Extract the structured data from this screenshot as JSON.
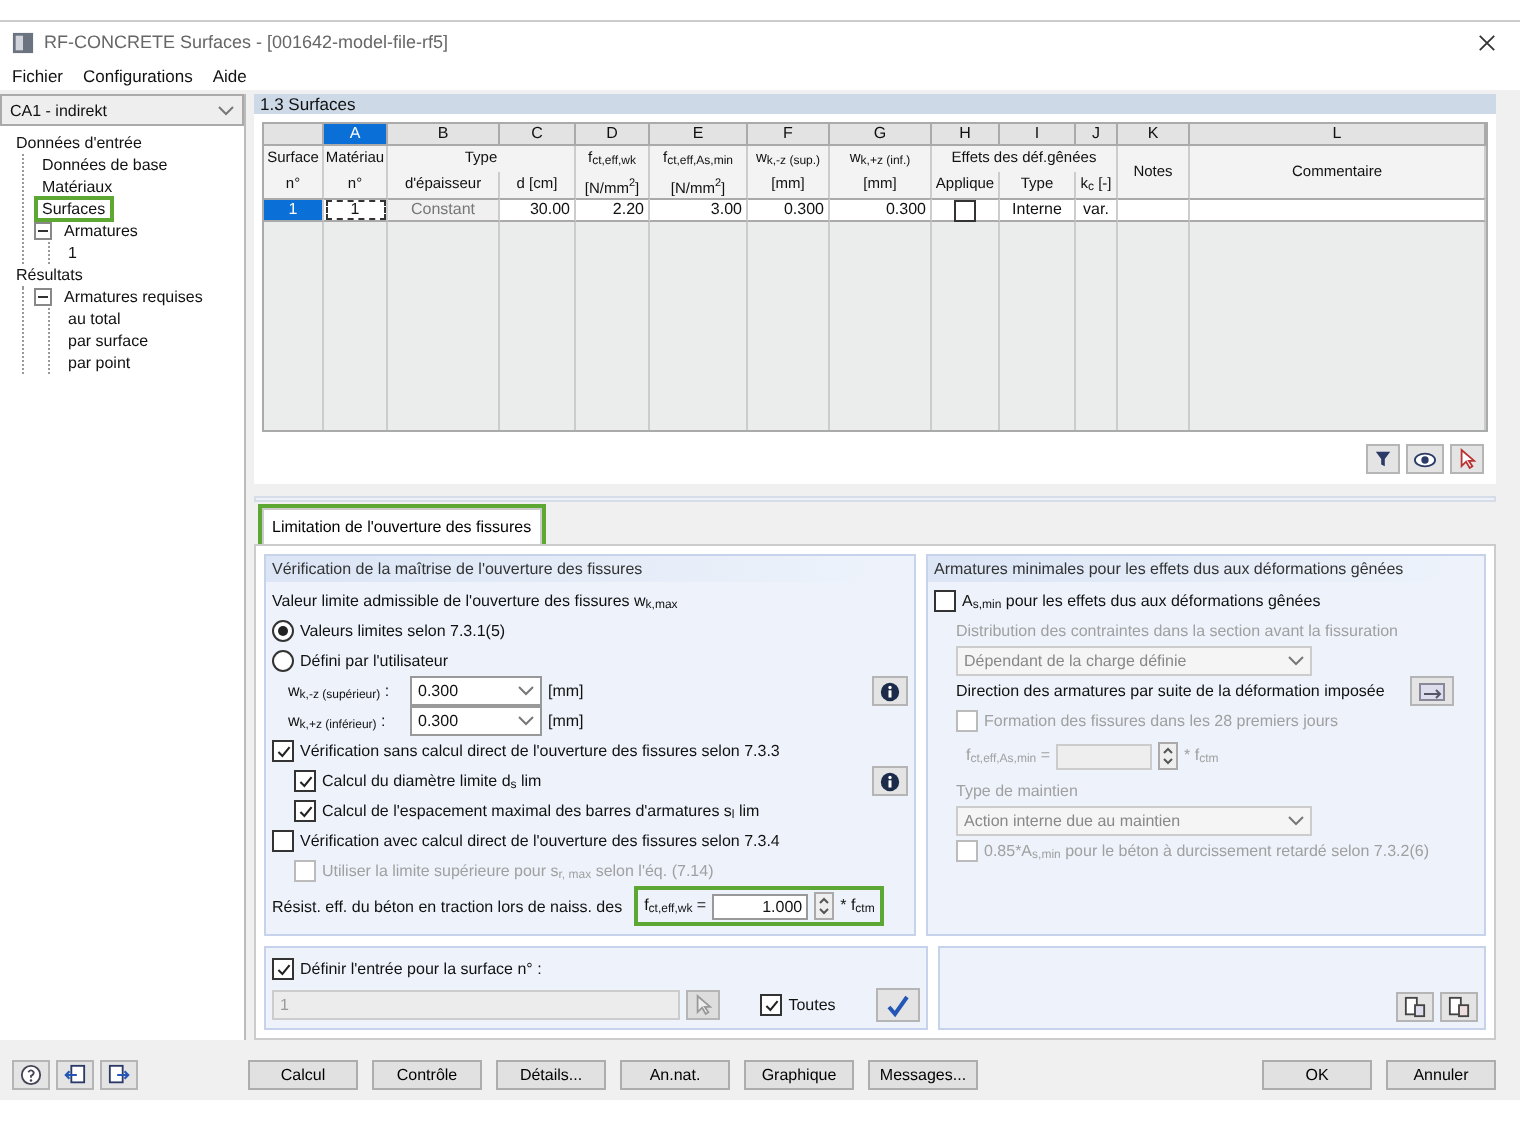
{
  "window": {
    "title": "RF-CONCRETE Surfaces - [001642-model-file-rf5]"
  },
  "menu": [
    "Fichier",
    "Configurations",
    "Aide"
  ],
  "case_select": {
    "value": "CA1 - indirekt"
  },
  "tree": [
    {
      "label": "Données d'entrée",
      "children": [
        {
          "label": "Données de base",
          "highlighted": false
        },
        {
          "label": "Matériaux",
          "highlighted": false
        },
        {
          "label": "Surfaces",
          "highlighted": true
        },
        {
          "label": "Armatures",
          "highlighted": false,
          "expanded": true,
          "children": [
            {
              "label": "1",
              "highlighted": false
            }
          ]
        }
      ]
    },
    {
      "label": "Résultats",
      "children": [
        {
          "label": "Armatures requises",
          "highlighted": false,
          "expanded": true,
          "children": [
            {
              "label": "au total",
              "highlighted": false
            },
            {
              "label": "par surface",
              "highlighted": false
            },
            {
              "label": "par point",
              "highlighted": false
            }
          ]
        }
      ]
    }
  ],
  "section_title": "1.3 Surfaces",
  "table": {
    "columns": [
      {
        "top": "Surface",
        "bottom": "n°",
        "selected": false
      },
      {
        "letter": "A",
        "top": "Matériau",
        "bottom": "n°",
        "selected": true
      },
      {
        "letter": "B",
        "top": "Type",
        "bottom": "d'épaisseur",
        "selected": false
      },
      {
        "letter": "C",
        "bottom": "d [cm]",
        "selected": false
      },
      {
        "letter": "D",
        "top": "f$_{ct,eff,wk}$",
        "bottom": "[N/mm$^{2}$]",
        "selected": false
      },
      {
        "letter": "E",
        "top": "f$_{ct,eff,As,min}$",
        "bottom": "[N/mm$^{2}$]",
        "selected": false
      },
      {
        "letter": "F",
        "top": "w$_{k,-z (sup.)}$",
        "bottom": "[mm]",
        "selected": false
      },
      {
        "letter": "G",
        "top": "w$_{k,+z (inf.)}$",
        "bottom": "[mm]",
        "selected": false
      },
      {
        "letter": "H",
        "top": "Effets des déf.gênées",
        "bottom": "Applique",
        "selected": false
      },
      {
        "letter": "I",
        "bottom": "Type",
        "selected": false
      },
      {
        "letter": "J",
        "bottom": "k$_{c}$ [-]",
        "selected": false
      },
      {
        "letter": "K",
        "header": "Notes",
        "selected": false
      },
      {
        "letter": "L",
        "header": "Commentaire",
        "selected": false
      }
    ],
    "rows": [
      {
        "selected": true,
        "cells": [
          {
            "kind": "id",
            "text": "1"
          },
          {
            "kind": "text",
            "text": "1",
            "focused": true,
            "disabled": false
          },
          {
            "kind": "text",
            "text": "Constant",
            "disabled": true,
            "focused": false
          },
          {
            "kind": "number",
            "text": "30.00"
          },
          {
            "kind": "number",
            "text": "2.20"
          },
          {
            "kind": "number",
            "text": "3.00"
          },
          {
            "kind": "number",
            "text": "0.300"
          },
          {
            "kind": "number",
            "text": "0.300"
          },
          {
            "kind": "check",
            "checked": false
          },
          {
            "kind": "text",
            "text": "Interne",
            "disabled": false,
            "focused": false
          },
          {
            "kind": "text",
            "text": "var.",
            "disabled": false,
            "focused": false
          }
        ]
      }
    ]
  },
  "tabs": [
    {
      "label": "Limitation de l'ouverture des fissures",
      "selected": true,
      "highlighted": true
    }
  ],
  "crack_group": {
    "title": "Vérification de la maîtrise de l'ouverture des fissures",
    "items": [
      {
        "kind": "heading",
        "text": "Valeur limite admissible de l'ouverture des fissures w$_{k,max}$"
      },
      {
        "kind": "radio",
        "label": "Valeurs limites selon 7.3.1(5)",
        "selected": true
      },
      {
        "kind": "radio",
        "label": "Défini par l'utilisateur",
        "selected": false
      },
      {
        "kind": "combo",
        "label": "w$_{k,-z (supérieur)}$ :",
        "value": "0.300",
        "unit": "[mm]",
        "info": true
      },
      {
        "kind": "combo",
        "label": "w$_{k,+z (inférieur)}$ :",
        "value": "0.300",
        "unit": "[mm]"
      },
      {
        "kind": "check",
        "label": "Vérification sans calcul direct de l'ouverture des fissures selon 7.3.3",
        "checked": true,
        "disabled": false,
        "children": [
          {
            "kind": "check",
            "label": "Calcul du diamètre limite d$_{s}$ lim",
            "checked": true,
            "disabled": false,
            "info": true
          },
          {
            "kind": "check",
            "label": "Calcul de l'espacement maximal des barres d'armatures s$_{l}$ lim",
            "checked": true,
            "disabled": false
          }
        ]
      },
      {
        "kind": "check",
        "label": "Vérification avec calcul direct de l'ouverture des fissures selon 7.3.4",
        "checked": false,
        "disabled": false,
        "children": [
          {
            "kind": "check",
            "label": "Utiliser la limite supérieure pour s$_{r, max}$ selon l'éq. (7.14)",
            "checked": false,
            "disabled": true
          }
        ]
      },
      {
        "kind": "spin",
        "label": "Résist. eff. du béton en traction lors de naiss. des",
        "symbol": "f$_{ct,eff,wk}$ =",
        "value": "1.000",
        "unit": "* f$_{ctm}$",
        "disabled": false,
        "highlighted": true
      }
    ]
  },
  "restraint_group": {
    "title": "Armatures minimales pour les effets dus aux déformations gênées",
    "items": [
      {
        "kind": "check",
        "label": "A$_{s,min}$ pour les effets dus aux déformations gênées",
        "checked": false,
        "disabled": false,
        "children": [
          {
            "kind": "text",
            "text": "Distribution des contraintes dans la section avant la fissuration",
            "disabled": true
          },
          {
            "kind": "combo",
            "value": "Dépendant de la charge définie",
            "disabled": true
          },
          {
            "kind": "action",
            "text": "Direction des armatures par suite de la déformation imposée"
          },
          {
            "kind": "check",
            "label": "Formation des fissures dans les 28 premiers jours",
            "checked": false,
            "disabled": true
          },
          {
            "kind": "spin",
            "symbol": "f$_{ct,eff,As,min}$ =",
            "unit": "* f$_{ctm}$",
            "disabled": true
          },
          {
            "kind": "text",
            "text": "Type de maintien",
            "disabled": true
          },
          {
            "kind": "combo",
            "value": "Action interne due au maintien",
            "disabled": true
          },
          {
            "kind": "check",
            "label": "0.85*A$_{s,min}$ pour le béton à durcissement retardé selon 7.3.2(6)",
            "checked": false,
            "disabled": true
          }
        ]
      }
    ]
  },
  "entry": {
    "label": "Définir l'entrée pour la surface n° :",
    "checked": true,
    "value": "1",
    "disabled": true,
    "all": {
      "label": "Toutes",
      "checked": true
    }
  },
  "buttons": [
    "Calcul",
    "Contrôle",
    "Détails...",
    "An.nat.",
    "Graphique",
    "Messages..."
  ],
  "dialog_buttons": [
    "OK",
    "Annuler"
  ]
}
